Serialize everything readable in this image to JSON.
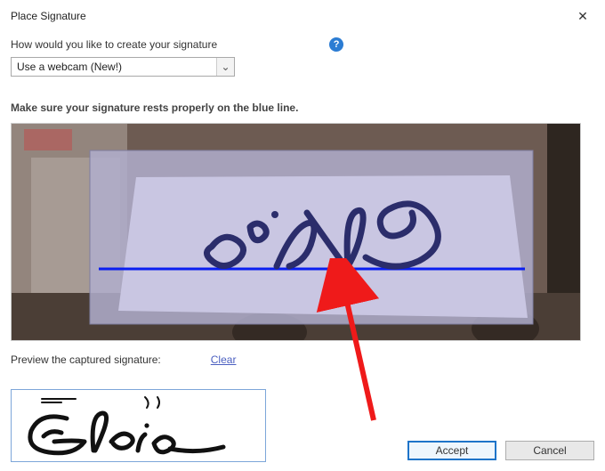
{
  "dialog": {
    "title": "Place Signature",
    "close_glyph": "✕"
  },
  "prompt": {
    "how_label": "How would you like to create your signature",
    "help_glyph": "?"
  },
  "dropdown": {
    "selected": "Use a webcam (New!)",
    "chevron_glyph": "⌄"
  },
  "instruction": "Make sure your signature rests properly on the blue line.",
  "preview_label": "Preview the captured signature:",
  "clear_label": "Clear",
  "buttons": {
    "accept": "Accept",
    "cancel": "Cancel"
  }
}
